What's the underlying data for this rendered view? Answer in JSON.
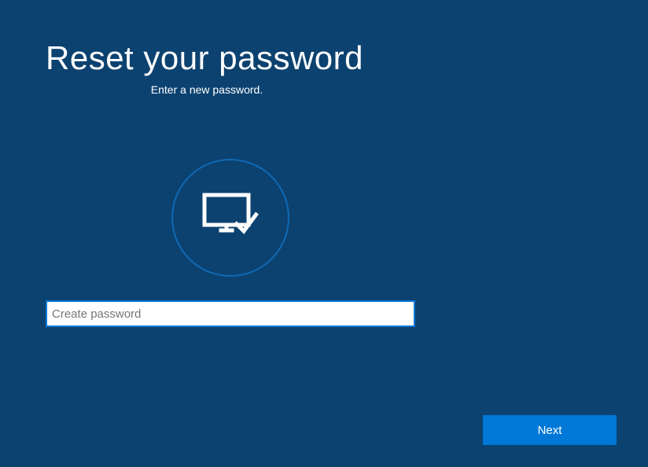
{
  "header": {
    "title": "Reset your password",
    "subtitle": "Enter a new password."
  },
  "form": {
    "password_placeholder": "Create password",
    "password_value": ""
  },
  "actions": {
    "next_label": "Next"
  },
  "icons": {
    "main": "monitor-check-icon"
  },
  "colors": {
    "background": "#0c4270",
    "accent": "#0078d7",
    "circle_border": "#0e6ab5"
  }
}
